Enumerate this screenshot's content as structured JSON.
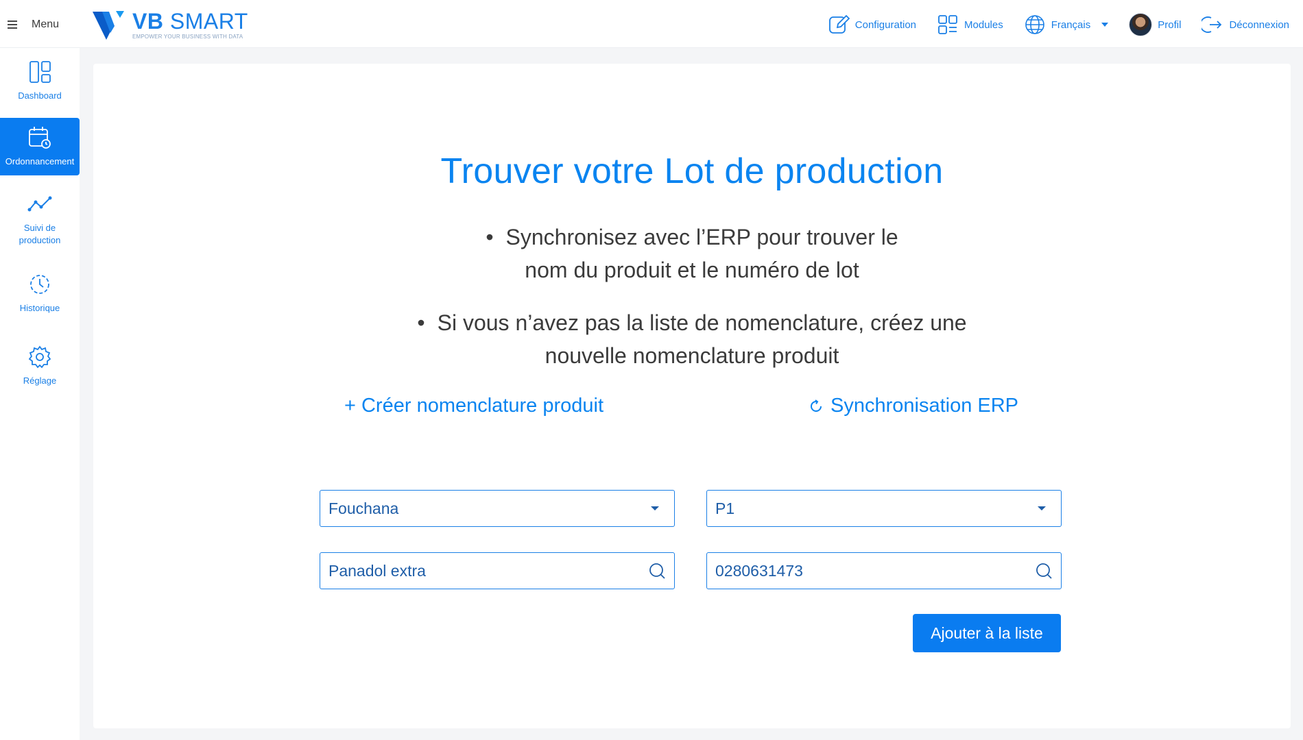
{
  "header": {
    "menu_label": "Menu",
    "logo": {
      "title_bold": "VB",
      "title_rest": " SMART",
      "tagline": "EMPOWER YOUR BUSINESS WITH DATA"
    },
    "nav": {
      "configuration": "Configuration",
      "modules": "Modules",
      "language": "Français",
      "profile": "Profil",
      "logout": "Déconnexion"
    }
  },
  "sidebar": {
    "items": [
      {
        "label": "Dashboard",
        "icon": "dashboard-icon"
      },
      {
        "label": "Ordonnancement",
        "icon": "calendar-clock-icon",
        "active": true
      },
      {
        "label": "Suivi de production",
        "icon": "trend-line-icon"
      },
      {
        "label": "Historique",
        "icon": "history-icon"
      },
      {
        "label": "Réglage",
        "icon": "gear-icon"
      }
    ]
  },
  "main": {
    "title": "Trouver votre Lot de production",
    "bullets": [
      {
        "line1": "Synchronisez avec l’ERP pour trouver le",
        "line2": "nom du produit et le numéro de lot"
      },
      {
        "line1": "Si vous n’avez pas  la liste de nomenclature, créez une",
        "line2": "nouvelle nomenclature produit"
      }
    ],
    "create_link": "+ Créer nomenclature  produit",
    "sync_link": "Synchronisation ERP",
    "fields": {
      "site": "Fouchana",
      "line": "P1",
      "product": "Panadol extra",
      "lot": "0280631473"
    },
    "add_button": "Ajouter à la liste"
  },
  "colors": {
    "accent": "#0a7cf0",
    "text_blue": "#1a7fe6",
    "background": "#f4f5f7"
  }
}
